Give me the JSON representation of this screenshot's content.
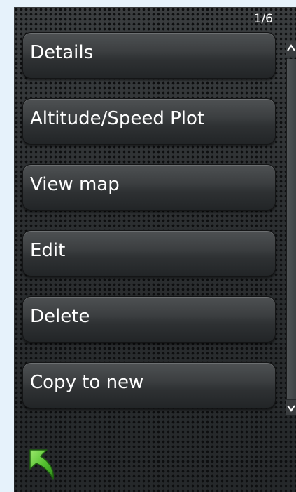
{
  "pager": {
    "label": "1/6"
  },
  "menu": {
    "items": [
      {
        "label": "Details"
      },
      {
        "label": "Altitude/Speed Plot"
      },
      {
        "label": "View map"
      },
      {
        "label": "Edit"
      },
      {
        "label": "Delete"
      },
      {
        "label": "Copy to new"
      }
    ]
  },
  "scrollbar": {
    "up_icon": "chevron-up-icon",
    "down_icon": "chevron-down-icon"
  },
  "back": {
    "icon": "back-arrow-icon"
  },
  "colors": {
    "page_background": "#e6f2fb",
    "screen_background": "#2a2d2f",
    "button_text": "#ffffff",
    "back_arrow": "#5cc733"
  }
}
